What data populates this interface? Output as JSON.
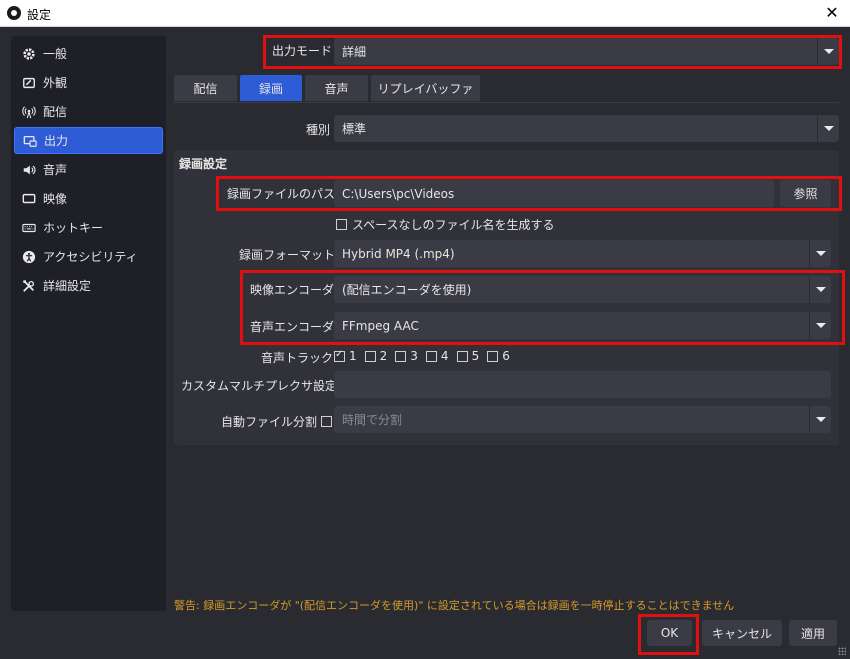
{
  "window": {
    "title": "設定",
    "close_label": "✕"
  },
  "sidebar": {
    "items": [
      {
        "label": "一般",
        "icon": "gear-icon"
      },
      {
        "label": "外観",
        "icon": "appearance-icon"
      },
      {
        "label": "配信",
        "icon": "broadcast-icon"
      },
      {
        "label": "出力",
        "icon": "output-icon",
        "active": true
      },
      {
        "label": "音声",
        "icon": "speaker-icon"
      },
      {
        "label": "映像",
        "icon": "monitor-icon"
      },
      {
        "label": "ホットキー",
        "icon": "keyboard-icon"
      },
      {
        "label": "アクセシビリティ",
        "icon": "accessibility-icon"
      },
      {
        "label": "詳細設定",
        "icon": "tools-icon"
      }
    ]
  },
  "output_mode": {
    "label": "出力モード",
    "value": "詳細"
  },
  "tabs": [
    {
      "label": "配信"
    },
    {
      "label": "録画",
      "active": true
    },
    {
      "label": "音声"
    },
    {
      "label": "リプレイバッファ"
    }
  ],
  "recording": {
    "type_label": "種別",
    "type_value": "標準",
    "section_title": "録画設定",
    "path_label": "録画ファイルのパス",
    "path_value": "C:\\Users\\pc\\Videos",
    "browse_label": "参照",
    "no_space_label": "スペースなしのファイル名を生成する",
    "format_label": "録画フォーマット",
    "format_value": "Hybrid MP4 (.mp4)",
    "video_encoder_label": "映像エンコーダ",
    "video_encoder_value": "(配信エンコーダを使用)",
    "audio_encoder_label": "音声エンコーダ",
    "audio_encoder_value": "FFmpeg AAC",
    "audio_track_label": "音声トラック",
    "tracks": [
      {
        "label": "1",
        "checked": true
      },
      {
        "label": "2",
        "checked": false
      },
      {
        "label": "3",
        "checked": false
      },
      {
        "label": "4",
        "checked": false
      },
      {
        "label": "5",
        "checked": false
      },
      {
        "label": "6",
        "checked": false
      }
    ],
    "muxer_label": "カスタムマルチプレクサ設定",
    "muxer_value": "",
    "auto_split_label": "自動ファイル分割",
    "auto_split_value": "時間で分割"
  },
  "warning": "警告: 録画エンコーダが \"(配信エンコーダを使用)\" に設定されている場合は録画を一時停止することはできません",
  "buttons": {
    "ok": "OK",
    "cancel": "キャンセル",
    "apply": "適用"
  },
  "colors": {
    "accent": "#2e5bd6",
    "highlight": "#e01010",
    "warning": "#d59a2a",
    "background": "#2a2b31"
  }
}
